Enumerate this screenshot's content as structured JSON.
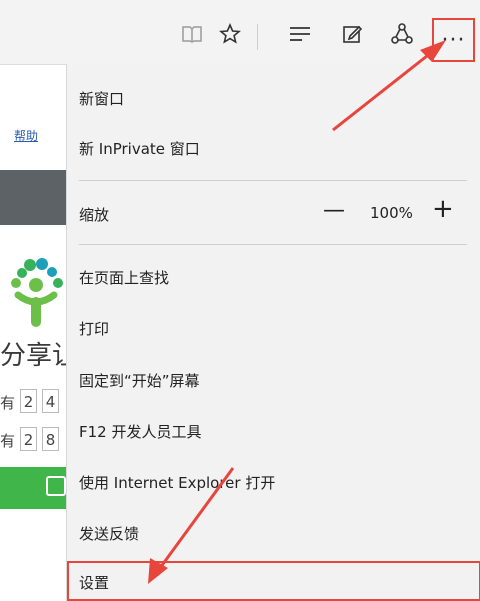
{
  "toolbar": {
    "icons": [
      "reading-view-icon",
      "favorites-star-icon",
      "hub-icon",
      "web-note-icon",
      "share-icon",
      "more-actions-icon"
    ],
    "more_label": "···"
  },
  "background_page": {
    "help_link": "帮助",
    "slogan": "分享让",
    "row1_label": "有",
    "row1_digits": [
      "2",
      "4"
    ],
    "row2_label": "有",
    "row2_digits": [
      "2",
      "8"
    ]
  },
  "menu": {
    "new_window": "新窗口",
    "new_inprivate": "新 InPrivate 窗口",
    "zoom_label": "缩放",
    "zoom_minus": "—",
    "zoom_value": "100%",
    "zoom_plus": "+",
    "find_on_page": "在页面上查找",
    "print": "打印",
    "pin_to_start": "固定到“开始”屏幕",
    "f12_tools": "F12 开发人员工具",
    "open_with_ie": "使用 Internet Explorer 打开",
    "send_feedback": "发送反馈",
    "settings": "设置"
  },
  "colors": {
    "highlight": "#e8453c",
    "menu_bg": "#f2f2f2",
    "toolbar_bg": "#f3f3f3",
    "green": "#3fb54a"
  }
}
